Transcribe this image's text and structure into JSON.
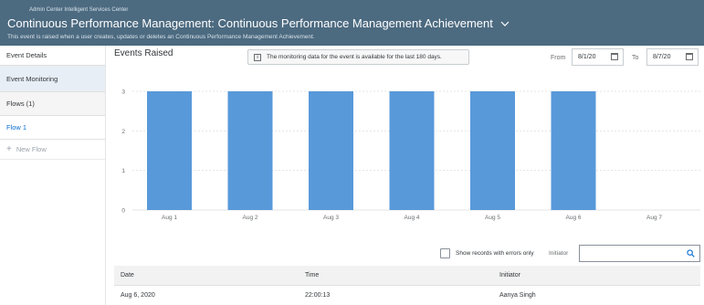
{
  "header": {
    "breadcrumb": "Admin Center   Intelligent Services Center",
    "title": "Continuous Performance Management: Continuous Performance Management Achievement",
    "subtitle": "This event is raised when a user creates, updates or deletes an Continuous Performance Management Achievement."
  },
  "sidebar": {
    "items": [
      {
        "label": "Event Details"
      },
      {
        "label": "Event Monitoring"
      },
      {
        "label": "Flows (1)"
      },
      {
        "label": "Flow 1"
      },
      {
        "label": "New Flow"
      }
    ]
  },
  "main": {
    "events_title": "Events Raised",
    "info_message": "The monitoring data for the event is available for the last 180 days.",
    "from_label": "From",
    "from_value": "8/1/20",
    "to_label": "To",
    "to_value": "8/7/20"
  },
  "chart_data": {
    "type": "bar",
    "categories": [
      "Aug 1",
      "Aug 2",
      "Aug 3",
      "Aug 4",
      "Aug 5",
      "Aug 6",
      "Aug 7"
    ],
    "values": [
      3,
      3,
      3,
      3,
      3,
      3,
      0
    ],
    "yticks": [
      0,
      1,
      2,
      3
    ],
    "ylim": [
      0,
      3
    ],
    "color": "#5899da",
    "grid": true
  },
  "filter": {
    "checkbox_label": "Show records with errors only",
    "initiator_label": "Initiator",
    "search_value": ""
  },
  "table": {
    "columns": [
      "Date",
      "Time",
      "Initiator"
    ],
    "rows": [
      [
        "Aug 6, 2020",
        "22:00:13",
        "Aanya Singh"
      ]
    ]
  }
}
